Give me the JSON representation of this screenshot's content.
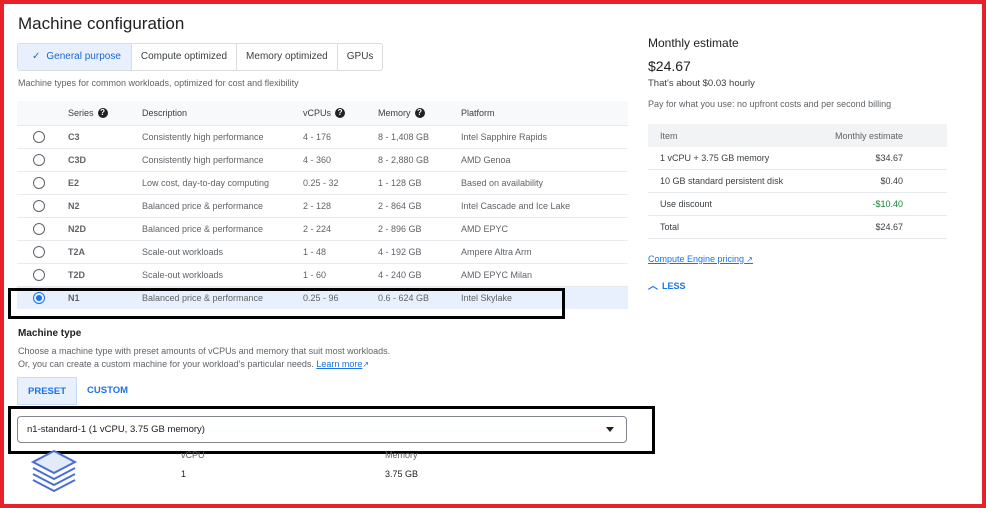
{
  "machine_configuration": {
    "title": "Machine configuration",
    "tabs": [
      {
        "label": "General purpose",
        "active": true
      },
      {
        "label": "Compute optimized",
        "active": false
      },
      {
        "label": "Memory optimized",
        "active": false
      },
      {
        "label": "GPUs",
        "active": false
      }
    ],
    "hint": "Machine types for common workloads, optimized for cost and flexibility"
  },
  "series_table": {
    "headers": {
      "series": "Series",
      "description": "Description",
      "vcpus": "vCPUs",
      "memory": "Memory",
      "platform": "Platform"
    },
    "rows": [
      {
        "series": "C3",
        "description": "Consistently high performance",
        "vcpus": "4 - 176",
        "memory": "8 - 1,408 GB",
        "platform": "Intel Sapphire Rapids",
        "selected": false
      },
      {
        "series": "C3D",
        "description": "Consistently high performance",
        "vcpus": "4 - 360",
        "memory": "8 - 2,880 GB",
        "platform": "AMD Genoa",
        "selected": false
      },
      {
        "series": "E2",
        "description": "Low cost, day-to-day computing",
        "vcpus": "0.25 - 32",
        "memory": "1 - 128 GB",
        "platform": "Based on availability",
        "selected": false
      },
      {
        "series": "N2",
        "description": "Balanced price & performance",
        "vcpus": "2 - 128",
        "memory": "2 - 864 GB",
        "platform": "Intel Cascade and Ice Lake",
        "selected": false
      },
      {
        "series": "N2D",
        "description": "Balanced price & performance",
        "vcpus": "2 - 224",
        "memory": "2 - 896 GB",
        "platform": "AMD EPYC",
        "selected": false
      },
      {
        "series": "T2A",
        "description": "Scale-out workloads",
        "vcpus": "1 - 48",
        "memory": "4 - 192 GB",
        "platform": "Ampere Altra Arm",
        "selected": false
      },
      {
        "series": "T2D",
        "description": "Scale-out workloads",
        "vcpus": "1 - 60",
        "memory": "4 - 240 GB",
        "platform": "AMD EPYC Milan",
        "selected": false
      },
      {
        "series": "N1",
        "description": "Balanced price & performance",
        "vcpus": "0.25 - 96",
        "memory": "0.6 - 624 GB",
        "platform": "Intel Skylake",
        "selected": true
      }
    ]
  },
  "machine_type": {
    "label": "Machine type",
    "desc_line1": "Choose a machine type with preset amounts of vCPUs and memory that suit most workloads.",
    "desc_line2": "Or, you can create a custom machine for your workload's particular needs.",
    "learn_more": "Learn more",
    "preset_tab": "PRESET",
    "custom_tab": "CUSTOM",
    "selected_value": "n1-standard-1 (1 vCPU, 3.75 GB memory)",
    "vcpu_header": "vCPU",
    "memory_header": "Memory",
    "vcpu_value": "1",
    "memory_value": "3.75 GB"
  },
  "estimate": {
    "title": "Monthly estimate",
    "price": "$24.67",
    "hourly": "That's about $0.03 hourly",
    "pay_as_you_go": "Pay for what you use: no upfront costs and per second billing",
    "headers": {
      "item": "Item",
      "monthly": "Monthly estimate"
    },
    "rows": [
      {
        "item": "1 vCPU + 3.75 GB memory",
        "amount": "$34.67"
      },
      {
        "item": "10 GB standard persistent disk",
        "amount": "$0.40"
      },
      {
        "item": "Use discount",
        "amount": "-$10.40"
      },
      {
        "item": "Total",
        "amount": "$24.67"
      }
    ],
    "pricing_link": "Compute Engine pricing",
    "less_label": "LESS"
  },
  "colors": {
    "accent": "#1a73e8",
    "highlight_border": "#e8202a",
    "selected_row": "#e8f0fe"
  }
}
